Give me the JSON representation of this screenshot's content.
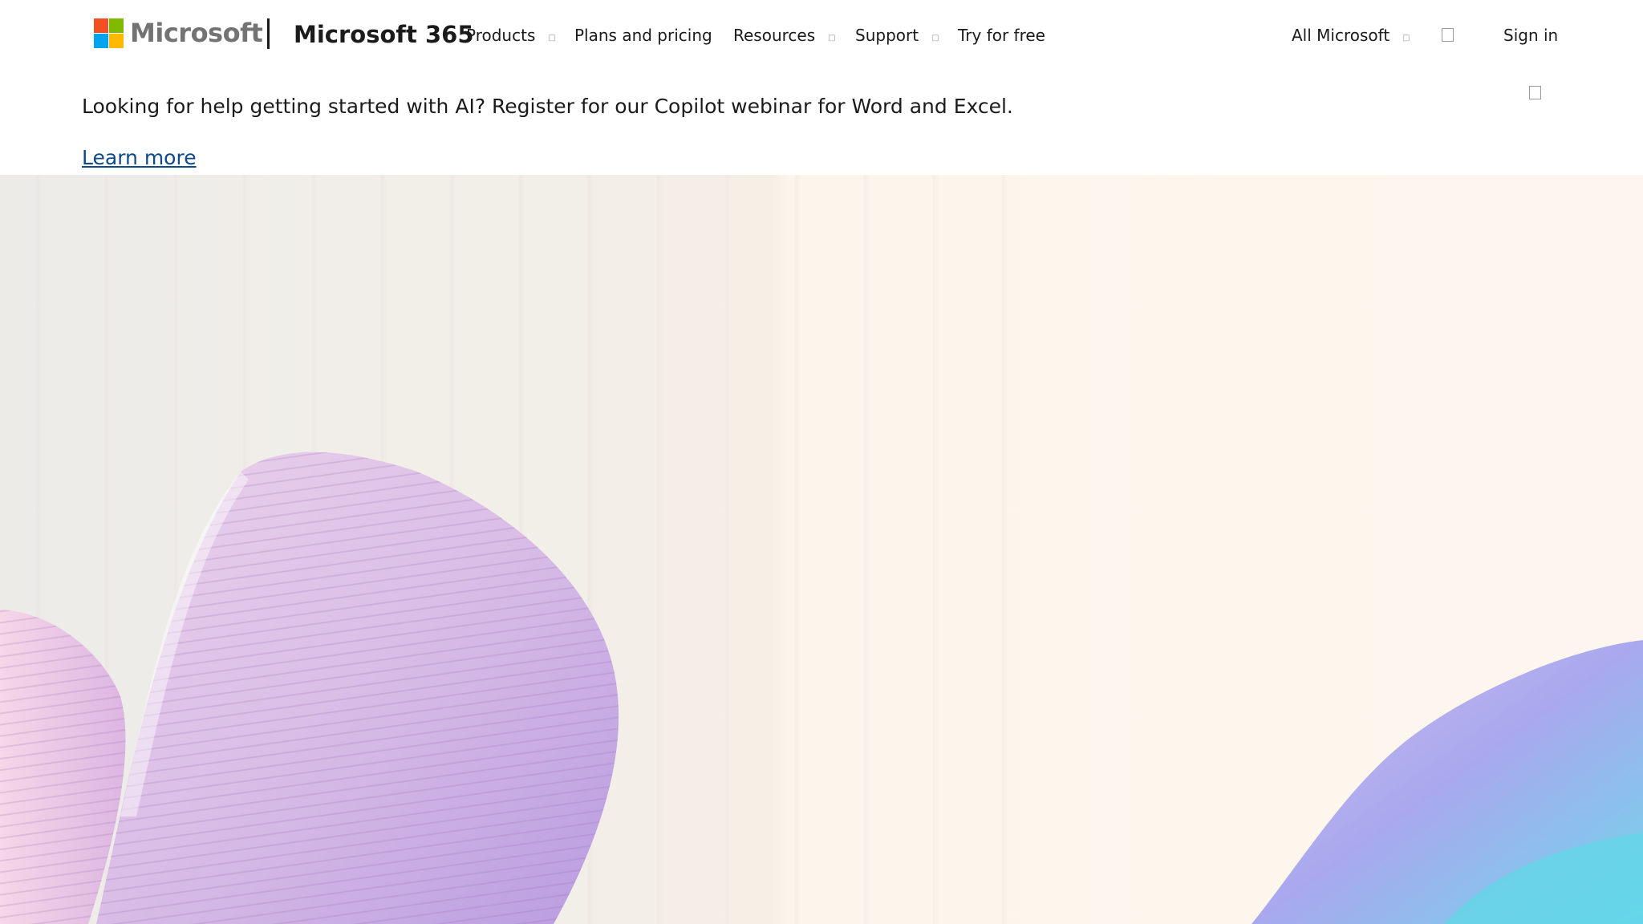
{
  "header": {
    "logo_text": "Microsoft",
    "logo_colors": [
      "#f25022",
      "#7fba00",
      "#00a4ef",
      "#ffb900"
    ],
    "product_title": "Microsoft 365",
    "nav": [
      {
        "label": "Products",
        "has_dropdown": true
      },
      {
        "label": "Plans and pricing",
        "has_dropdown": false
      },
      {
        "label": "Resources",
        "has_dropdown": true
      },
      {
        "label": "Support",
        "has_dropdown": true
      },
      {
        "label": "Try for free",
        "has_dropdown": false
      }
    ],
    "all_microsoft_label": "All Microsoft",
    "search_icon": "search-icon",
    "sign_in_label": "Sign in"
  },
  "banner": {
    "text": "Looking for help getting started with AI? Register for our Copilot webinar for Word and Excel.",
    "link_label": "Learn more",
    "link_color": "#0e4a8a",
    "close_icon": "close-icon"
  },
  "hero": {
    "background_colors": [
      "#ecebe8",
      "#fcf5ec"
    ],
    "ribbon_colors": [
      "#e3c6e6",
      "#b79be0",
      "#8fd6ea"
    ]
  }
}
